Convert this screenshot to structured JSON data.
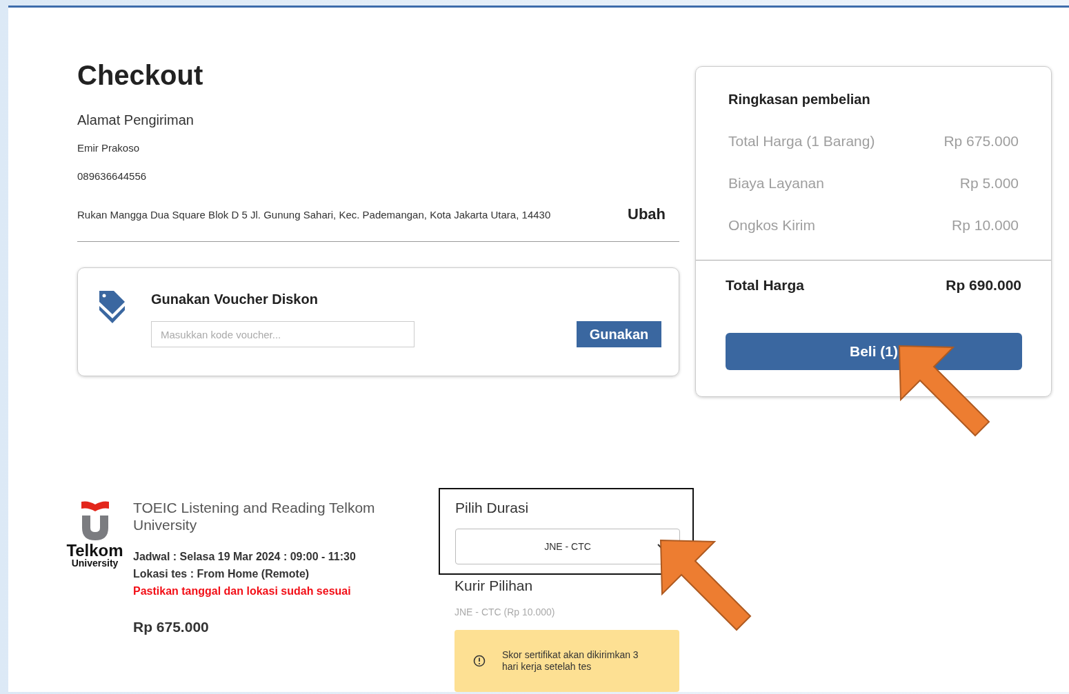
{
  "page": {
    "title": "Checkout"
  },
  "address": {
    "heading": "Alamat Pengiriman",
    "name": "Emir Prakoso",
    "phone": "089636644556",
    "address": "Rukan Mangga Dua Square Blok D 5 Jl. Gunung Sahari, Kec. Pademangan, Kota Jakarta Utara, 14430",
    "edit_link": "Ubah"
  },
  "voucher": {
    "title": "Gunakan Voucher Diskon",
    "placeholder": "Masukkan kode voucher...",
    "button": "Gunakan"
  },
  "summary": {
    "title": "Ringkasan pembelian",
    "rows": [
      {
        "label": "Total Harga (1 Barang)",
        "value": "Rp 675.000"
      },
      {
        "label": "Biaya Layanan",
        "value": "Rp 5.000"
      },
      {
        "label": "Ongkos Kirim",
        "value": "Rp 10.000"
      }
    ],
    "total_label": "Total Harga",
    "total_value": "Rp 690.000",
    "buy_button": "Beli (1)"
  },
  "product": {
    "logo": {
      "name": "Telkom",
      "subtitle": "University"
    },
    "title": "TOEIC Listening and Reading Telkom University",
    "schedule": "Jadwal : Selasa 19 Mar 2024 : 09:00 - 11:30",
    "location": "Lokasi tes : From Home (Remote)",
    "warning": "Pastikan tanggal dan lokasi sudah sesuai",
    "price": "Rp 675.000"
  },
  "shipping": {
    "duration_label": "Pilih Durasi",
    "duration_value": "JNE - CTC",
    "courier_label": "Kurir Pilihan",
    "courier_value": "JNE - CTC (Rp 10.000)",
    "notice": "Skor sertifikat akan dikirimkan 3 hari kerja setelah tes"
  }
}
